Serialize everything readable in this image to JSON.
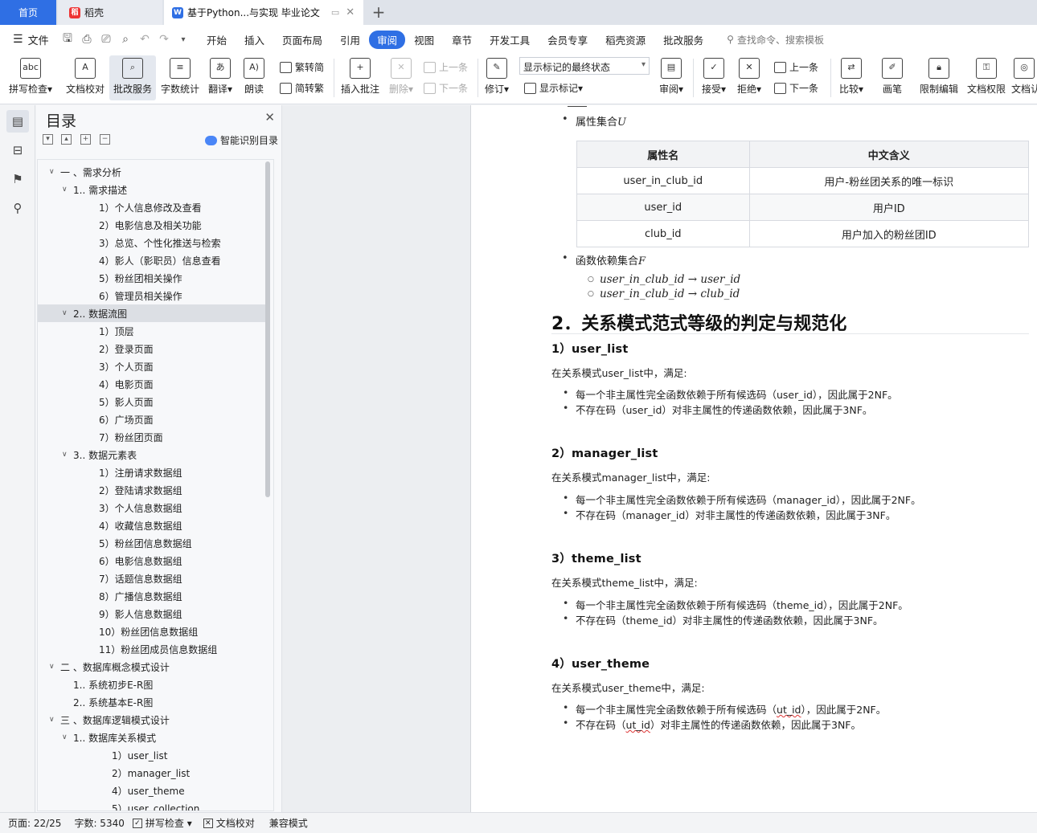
{
  "tabs": {
    "home": "首页",
    "daoke": "稻壳",
    "doc": "基于Python...与实现 毕业论文"
  },
  "menu": {
    "file": "文件",
    "items": [
      "开始",
      "插入",
      "页面布局",
      "引用",
      "审阅",
      "视图",
      "章节",
      "开发工具",
      "会员专享",
      "稻壳资源",
      "批改服务"
    ],
    "active": "审阅",
    "search": "查找命令、搜索模板"
  },
  "ribbon": {
    "spell": "拼写检查",
    "proof": "文档校对",
    "correct": "批改服务",
    "wordcount": "字数统计",
    "translate": "翻译",
    "read": "朗读",
    "trad": "繁转简",
    "simp": "简转繁",
    "insert_comment": "插入批注",
    "delete": "删除",
    "prev_comment": "上一条",
    "next_comment": "下一条",
    "revise": "修订",
    "markup_state": "显示标记的最终状态",
    "show_markup": "显示标记",
    "review": "审阅",
    "accept": "接受",
    "reject": "拒绝",
    "prev": "上一条",
    "next": "下一条",
    "compare": "比较",
    "pen": "画笔",
    "restrict": "限制编辑",
    "permission": "文档权限",
    "auth": "文档认"
  },
  "toc": {
    "title": "目录",
    "smart": "智能识别目录",
    "items": [
      {
        "label": "一 、需求分析",
        "level": 1,
        "chev": true
      },
      {
        "label": "1.. 需求描述",
        "level": 2,
        "chev": true
      },
      {
        "label": "1）个人信息修改及查看",
        "level": 3
      },
      {
        "label": "2）电影信息及相关功能",
        "level": 3
      },
      {
        "label": "3）总览、个性化推送与检索",
        "level": 3
      },
      {
        "label": "4）影人（影职员）信息查看",
        "level": 3
      },
      {
        "label": "5）粉丝团相关操作",
        "level": 3
      },
      {
        "label": "6）管理员相关操作",
        "level": 3
      },
      {
        "label": "2.. 数据流图",
        "level": 2,
        "chev": true,
        "selected": true
      },
      {
        "label": "1）顶层",
        "level": 3
      },
      {
        "label": "2）登录页面",
        "level": 3
      },
      {
        "label": "3）个人页面",
        "level": 3
      },
      {
        "label": "4）电影页面",
        "level": 3
      },
      {
        "label": "5）影人页面",
        "level": 3
      },
      {
        "label": "6）广场页面",
        "level": 3
      },
      {
        "label": "7）粉丝团页面",
        "level": 3
      },
      {
        "label": "3.. 数据元素表",
        "level": 2,
        "chev": true
      },
      {
        "label": "1）注册请求数据组",
        "level": 3
      },
      {
        "label": "2）登陆请求数据组",
        "level": 3
      },
      {
        "label": "3）个人信息数据组",
        "level": 3
      },
      {
        "label": "4）收藏信息数据组",
        "level": 3
      },
      {
        "label": "5）粉丝团信息数据组",
        "level": 3
      },
      {
        "label": "6）电影信息数据组",
        "level": 3
      },
      {
        "label": "7）话题信息数据组",
        "level": 3
      },
      {
        "label": "8）广播信息数据组",
        "level": 3
      },
      {
        "label": "9）影人信息数据组",
        "level": 3
      },
      {
        "label": "10）粉丝团信息数据组",
        "level": 3
      },
      {
        "label": "11）粉丝团成员信息数据组",
        "level": 3
      },
      {
        "label": "二 、数据库概念模式设计",
        "level": 1,
        "chev": true
      },
      {
        "label": "1.. 系统初步E-R图",
        "level": 2
      },
      {
        "label": "2.. 系统基本E-R图",
        "level": 2
      },
      {
        "label": "三 、数据库逻辑模式设计",
        "level": 1,
        "chev": true
      },
      {
        "label": "1.. 数据库关系模式",
        "level": 2,
        "chev": true
      },
      {
        "label": "1）user_list",
        "level": 4
      },
      {
        "label": "2）manager_list",
        "level": 4
      },
      {
        "label": "4）user_theme",
        "level": 4
      },
      {
        "label": "5）user_collection",
        "level": 4
      }
    ]
  },
  "doc": {
    "attr_set": "属性集合",
    "attr_sym": "U",
    "table": {
      "headers": [
        "属性名",
        "中文含义"
      ],
      "rows": [
        [
          "user_in_club_id",
          "用户-粉丝团关系的唯一标识"
        ],
        [
          "user_id",
          "用户ID"
        ],
        [
          "club_id",
          "用户加入的粉丝团ID"
        ]
      ]
    },
    "fd_set": "函数依赖集合",
    "fd_sym": "F",
    "fd1": "user_in_club_id → user_id",
    "fd2": "user_in_club_id → club_id",
    "h2": "2．关系模式范式等级的判定与规范化",
    "sections": [
      {
        "title": "1）user_list",
        "intro": "在关系模式user_list中，满足:",
        "b1": "每一个非主属性完全函数依赖于所有候选码（user_id），因此属于2NF。",
        "b2": "不存在码（user_id）对非主属性的传递函数依赖，因此属于3NF。"
      },
      {
        "title": "2）manager_list",
        "intro": "在关系模式manager_list中，满足:",
        "b1": "每一个非主属性完全函数依赖于所有候选码（manager_id），因此属于2NF。",
        "b2": "不存在码（manager_id）对非主属性的传递函数依赖，因此属于3NF。"
      },
      {
        "title": "3）theme_list",
        "intro": "在关系模式theme_list中，满足:",
        "b1": "每一个非主属性完全函数依赖于所有候选码（theme_id），因此属于2NF。",
        "b2": "不存在码（theme_id）对非主属性的传递函数依赖，因此属于3NF。"
      },
      {
        "title": "4）user_theme",
        "intro": "在关系模式user_theme中，满足:",
        "b1_pre": "每一个非主属性完全函数依赖于所有候选码（",
        "b1_key": "ut_id",
        "b1_post": "），因此属于2NF。",
        "b2_pre": "不存在码（",
        "b2_key": "ut_id",
        "b2_post": "）对非主属性的传递函数依赖，因此属于3NF。"
      }
    ]
  },
  "status": {
    "page": "页面: 22/25",
    "words": "字数: 5340",
    "spell": "拼写检查",
    "proof": "文档校对",
    "compat": "兼容模式"
  },
  "colors": {
    "accent": "#2f6fe4"
  }
}
